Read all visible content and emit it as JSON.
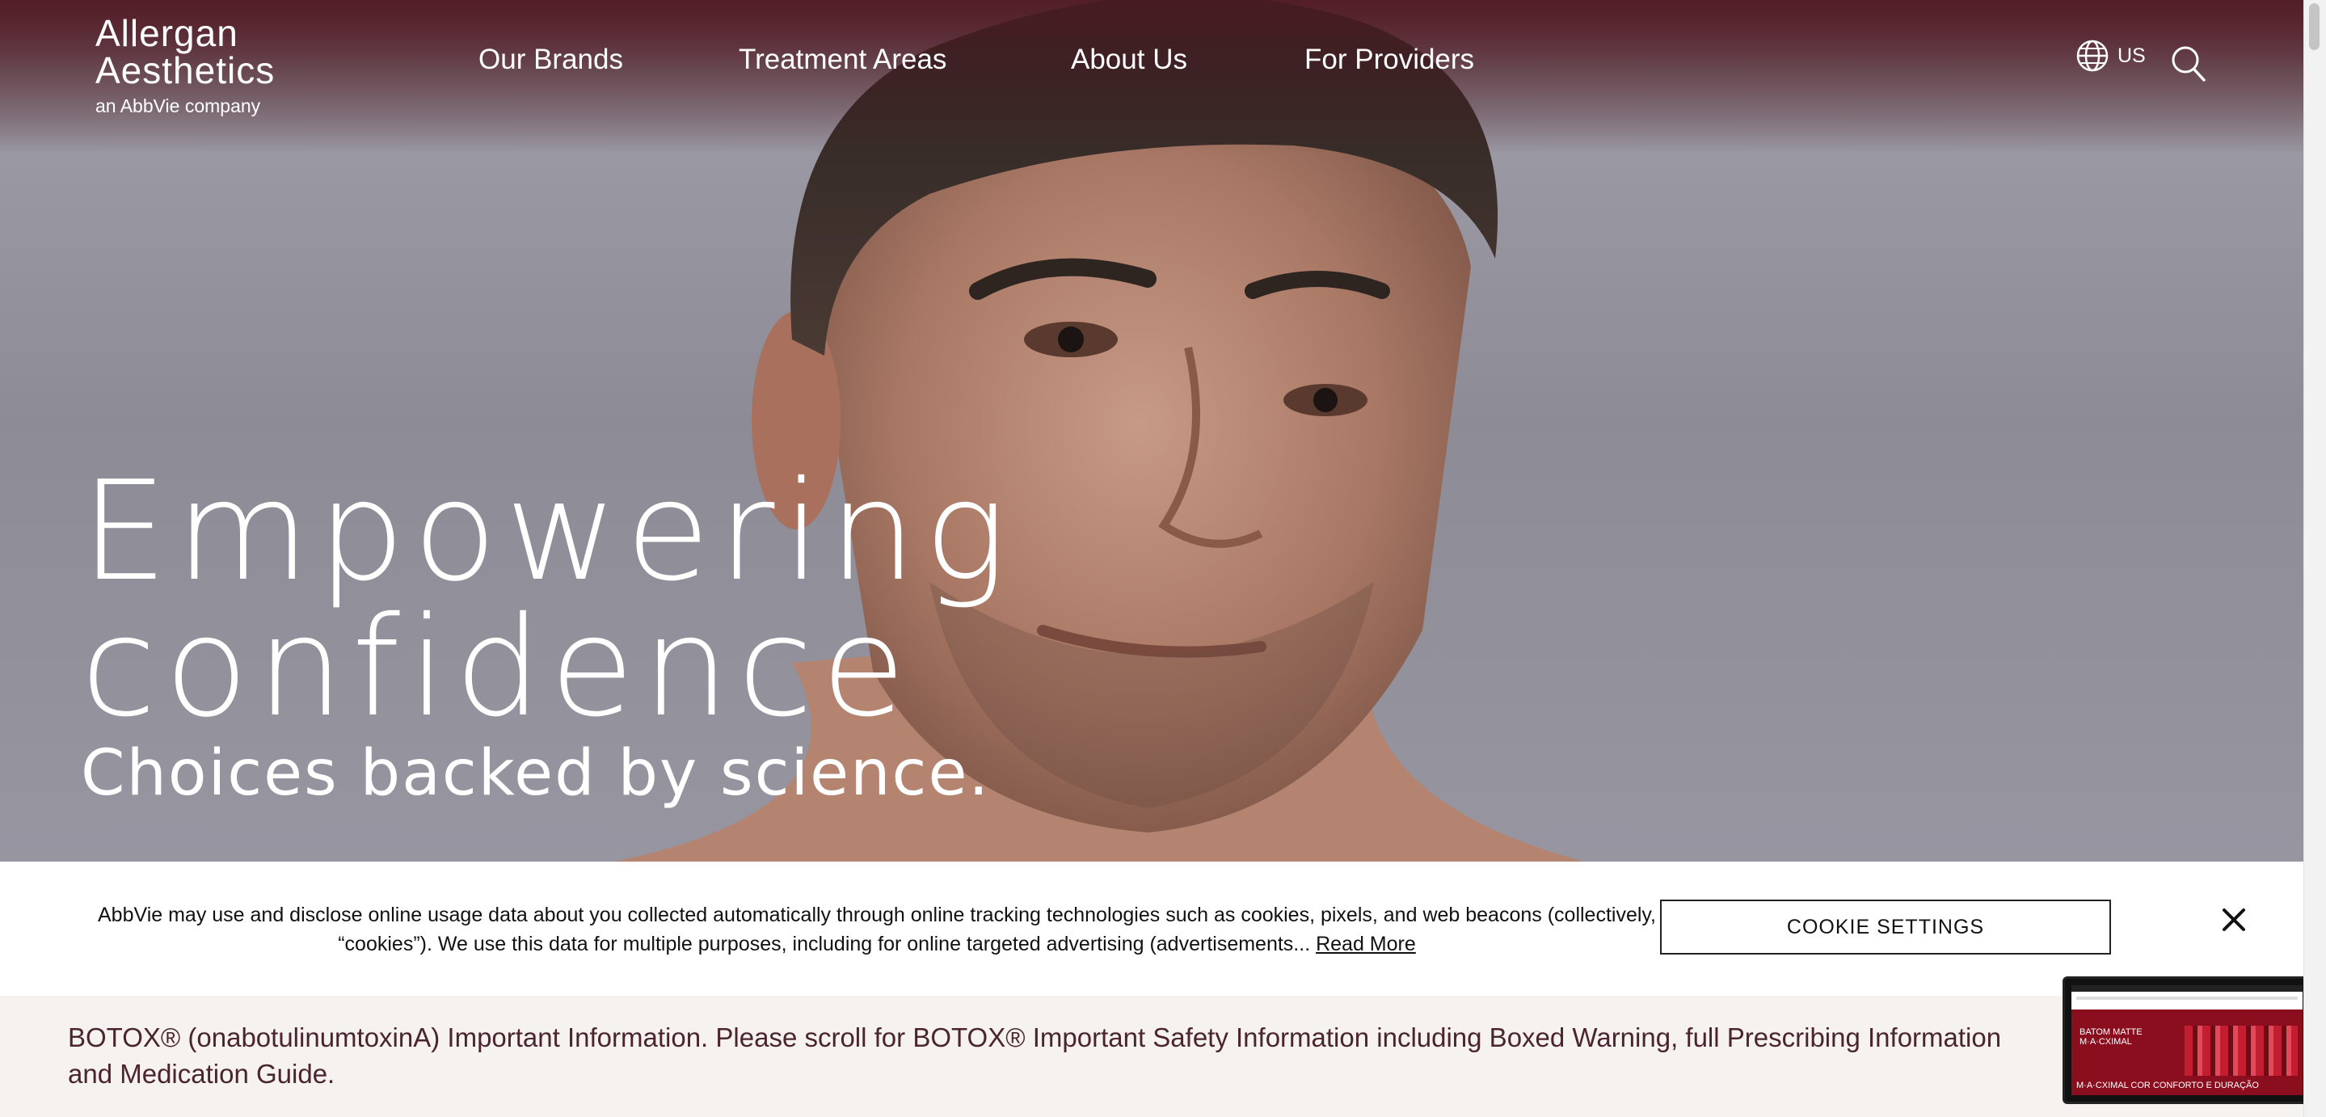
{
  "brand": {
    "line1": "Allergan",
    "line2": "Aesthetics",
    "tagline": "an AbbVie company"
  },
  "nav": {
    "items": [
      {
        "label": "Our Brands"
      },
      {
        "label": "Treatment Areas"
      },
      {
        "label": "About Us"
      },
      {
        "label": "For Providers"
      }
    ]
  },
  "locale": {
    "label": "US",
    "icon": "globe-icon"
  },
  "search": {
    "icon": "search-icon"
  },
  "hero": {
    "headline_line1": "Empowering",
    "headline_line2": "confidence",
    "subline": "Choices backed by science."
  },
  "cookie_banner": {
    "text": "AbbVie may use and disclose online usage data about you collected automatically through online tracking technologies such as cookies, pixels, and web beacons (collectively, “cookies”). We use this data for multiple purposes, including for online targeted advertising (advertisements... ",
    "read_more": "Read More",
    "settings_label": "COOKIE SETTINGS",
    "close_icon": "close-icon"
  },
  "isi": {
    "text": "BOTOX® (onabotulinumtoxinA) Important Information. Please scroll for BOTOX® Important Safety Information including Boxed Warning, full Prescribing Information and Medication Guide."
  },
  "video_thumbnail": {
    "line1": "BATOM MATTE",
    "line2": "M·A·CXIMAL",
    "caption": "M·A·CXIMAL COR CONFORTO E DURAÇÃO"
  },
  "colors": {
    "header_tint": "#5a2a33",
    "isi_background": "#f6f2ef",
    "isi_text": "#4a2530",
    "hero_text": "#ffffff"
  }
}
